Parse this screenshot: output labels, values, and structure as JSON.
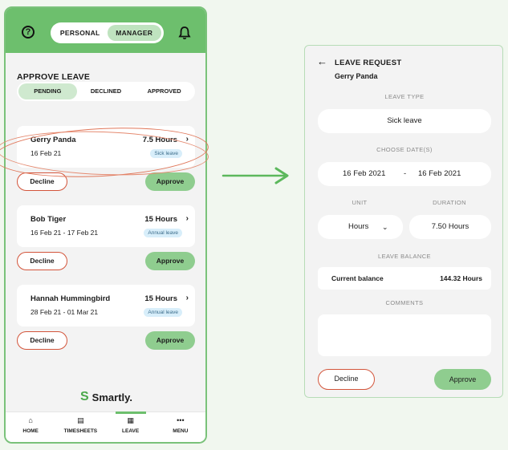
{
  "manager_app": {
    "mode_tabs": [
      "PERSONAL",
      "MANAGER"
    ],
    "section_title": "APPROVE LEAVE",
    "filter_tabs": [
      "PENDING",
      "DECLINED",
      "APPROVED"
    ],
    "requests": [
      {
        "name": "Gerry Panda",
        "date": "16 Feb 21",
        "hours": "7.5 Hours",
        "type": "Sick leave"
      },
      {
        "name": "Bob Tiger",
        "date": "16 Feb 21 - 17 Feb 21",
        "hours": "15 Hours",
        "type": "Annual leave"
      },
      {
        "name": "Hannah Hummingbird",
        "date": "28 Feb 21 - 01 Mar 21",
        "hours": "15 Hours",
        "type": "Annual leave"
      }
    ],
    "decline_label": "Decline",
    "approve_label": "Approve",
    "logo_text": "Smartly.",
    "nav": [
      "HOME",
      "TIMESHEETS",
      "LEAVE",
      "MENU"
    ]
  },
  "leave_request": {
    "title": "LEAVE REQUEST",
    "employee": "Gerry Panda",
    "leave_type_label": "LEAVE TYPE",
    "leave_type": "Sick leave",
    "dates_label": "CHOOSE DATE(S)",
    "start_date": "16 Feb 2021",
    "date_separator": "-",
    "end_date": "16 Feb 2021",
    "unit_label": "UNIT",
    "unit": "Hours",
    "duration_label": "DURATION",
    "duration": "7.50 Hours",
    "balance_label": "LEAVE BALANCE",
    "balance_name": "Current balance",
    "balance_value": "144.32 Hours",
    "comments_label": "COMMENTS",
    "decline_label": "Decline",
    "approve_label": "Approve"
  },
  "colors": {
    "brand_green": "#6dbf6d",
    "decline_red": "#d3553b",
    "arrow_green": "#5cb85c"
  }
}
